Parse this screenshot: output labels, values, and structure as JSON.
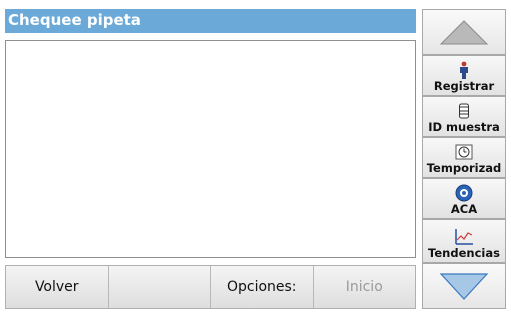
{
  "window": {
    "title": "Chequee pipeta"
  },
  "bottom_bar": {
    "back_label": "Volver",
    "empty_label": "",
    "options_label": "Opciones:",
    "start_label": "Inicio"
  },
  "sidebar": {
    "items": [
      {
        "label": "Registrar",
        "icon": "person-icon"
      },
      {
        "label": "ID muestra",
        "icon": "sample-vial-icon"
      },
      {
        "label": "Temporizad",
        "icon": "timer-icon"
      },
      {
        "label": "ACA",
        "icon": "aca-icon"
      },
      {
        "label": "Tendencias",
        "icon": "trend-chart-icon"
      }
    ]
  },
  "colors": {
    "title_bar": "#6baad8",
    "arrow_fill": "#a6c8e6",
    "arrow_up_fill": "#b9b9b9"
  }
}
